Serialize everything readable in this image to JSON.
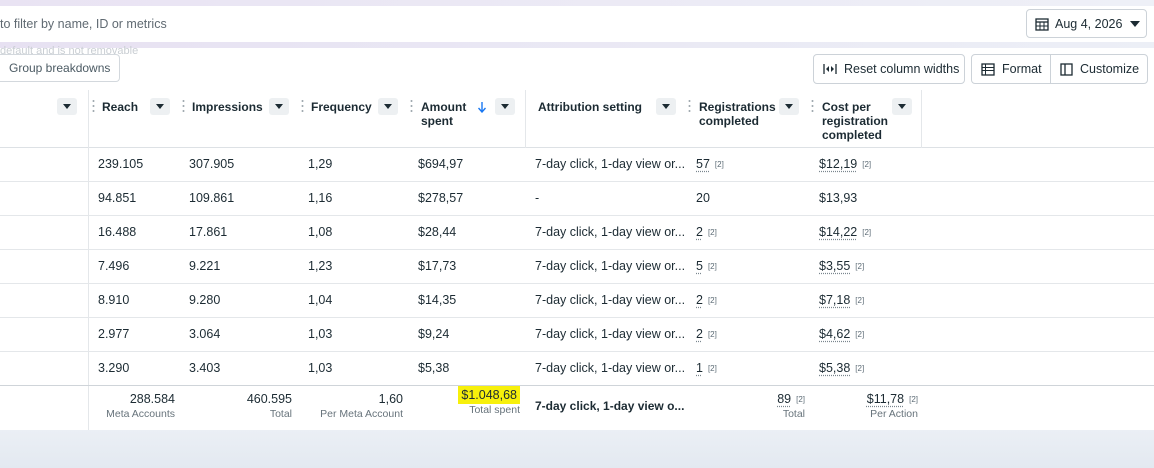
{
  "filter": {
    "placeholder": "to filter by name, ID or metrics"
  },
  "date_range": {
    "label": "Aug 4, 2026"
  },
  "toolbar": {
    "ghost_note": "default and is not removable",
    "group_breakdowns": "Group breakdowns",
    "reset_widths": "Reset column widths",
    "format": "Format",
    "customize": "Customize"
  },
  "columns": {
    "reach": "Reach",
    "impressions": "Impressions",
    "frequency": "Frequency",
    "amount_spent_1": "Amount",
    "amount_spent_2": "spent",
    "attribution": "Attribution setting",
    "registrations_1": "Registrations",
    "registrations_2": "completed",
    "cost_1": "Cost per",
    "cost_2": "registration",
    "cost_3": "completed"
  },
  "rows": [
    {
      "reach": "239.105",
      "impressions": "307.905",
      "frequency": "1,29",
      "spent": "$694,97",
      "attribution": "7-day click, 1-day view or...",
      "registrations": "57",
      "reg_note": "[2]",
      "cost": "$12,19",
      "cost_note": "[2]"
    },
    {
      "reach": "94.851",
      "impressions": "109.861",
      "frequency": "1,16",
      "spent": "$278,57",
      "attribution": "-",
      "registrations": "20",
      "reg_note": "",
      "cost": "$13,93",
      "cost_note": ""
    },
    {
      "reach": "16.488",
      "impressions": "17.861",
      "frequency": "1,08",
      "spent": "$28,44",
      "attribution": "7-day click, 1-day view or...",
      "registrations": "2",
      "reg_note": "[2]",
      "cost": "$14,22",
      "cost_note": "[2]"
    },
    {
      "reach": "7.496",
      "impressions": "9.221",
      "frequency": "1,23",
      "spent": "$17,73",
      "attribution": "7-day click, 1-day view or...",
      "registrations": "5",
      "reg_note": "[2]",
      "cost": "$3,55",
      "cost_note": "[2]"
    },
    {
      "reach": "8.910",
      "impressions": "9.280",
      "frequency": "1,04",
      "spent": "$14,35",
      "attribution": "7-day click, 1-day view or...",
      "registrations": "2",
      "reg_note": "[2]",
      "cost": "$7,18",
      "cost_note": "[2]"
    },
    {
      "reach": "2.977",
      "impressions": "3.064",
      "frequency": "1,03",
      "spent": "$9,24",
      "attribution": "7-day click, 1-day view or...",
      "registrations": "2",
      "reg_note": "[2]",
      "cost": "$4,62",
      "cost_note": "[2]"
    },
    {
      "reach": "3.290",
      "impressions": "3.403",
      "frequency": "1,03",
      "spent": "$5,38",
      "attribution": "7-day click, 1-day view or...",
      "registrations": "1",
      "reg_note": "[2]",
      "cost": "$5,38",
      "cost_note": "[2]"
    }
  ],
  "totals": {
    "reach": "288.584",
    "reach_label": "Meta Accounts",
    "impressions": "460.595",
    "impressions_label": "Total",
    "frequency": "1,60",
    "frequency_label": "Per Meta Account",
    "spent": "$1.048,68",
    "spent_label": "Total spent",
    "attribution": "7-day click, 1-day view o...",
    "registrations": "89",
    "registrations_note": "[2]",
    "registrations_label": "Total",
    "cost": "$11,78",
    "cost_note": "[2]",
    "cost_label": "Per Action"
  },
  "colors": {
    "highlight": "#f7f00b",
    "accent_sort": "#1877f2"
  }
}
